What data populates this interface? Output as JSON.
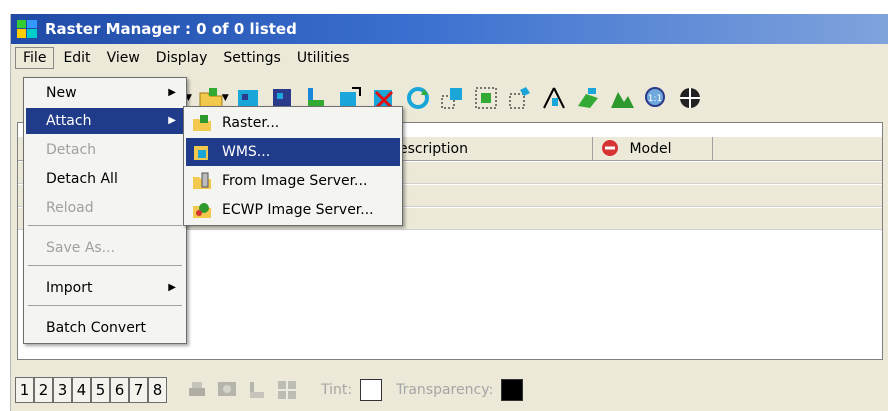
{
  "window": {
    "title": "Raster Manager : 0 of 0 listed"
  },
  "menubar": {
    "items": [
      {
        "label": "File"
      },
      {
        "label": "Edit"
      },
      {
        "label": "View"
      },
      {
        "label": "Display"
      },
      {
        "label": "Settings"
      },
      {
        "label": "Utilities"
      }
    ]
  },
  "file_menu": {
    "items": [
      {
        "label": "New",
        "enabled": true,
        "submenu": true
      },
      {
        "label": "Attach",
        "enabled": true,
        "submenu": true,
        "highlighted": true
      },
      {
        "label": "Detach",
        "enabled": false
      },
      {
        "label": "Detach All",
        "enabled": true
      },
      {
        "label": "Reload",
        "enabled": false
      },
      {
        "label": "Save As...",
        "enabled": false
      },
      {
        "label": "Import",
        "enabled": true,
        "submenu": true
      },
      {
        "label": "Batch Convert",
        "enabled": true
      }
    ]
  },
  "attach_submenu": {
    "items": [
      {
        "label": "Raster...",
        "icon": "raster-attach-icon"
      },
      {
        "label": "WMS...",
        "icon": "wms-attach-icon",
        "highlighted": true
      },
      {
        "label": "From Image Server...",
        "icon": "image-server-icon"
      },
      {
        "label": "ECWP Image Server...",
        "icon": "ecwp-server-icon"
      }
    ]
  },
  "list": {
    "columns": [
      {
        "label": "escription"
      },
      {
        "label": "Model",
        "icon": "no-entry-icon"
      }
    ]
  },
  "bottombar": {
    "view_buttons": [
      "1",
      "2",
      "3",
      "4",
      "5",
      "6",
      "7",
      "8"
    ],
    "tint_label": "Tint:",
    "transparency_label": "Transparency:",
    "tint_color": "#ffffff",
    "transparency_color": "#000000"
  },
  "colors": {
    "title_bar": "#1f4aa5",
    "menu_highlight": "#1f3b8a",
    "window_bg": "#ece9d8"
  }
}
